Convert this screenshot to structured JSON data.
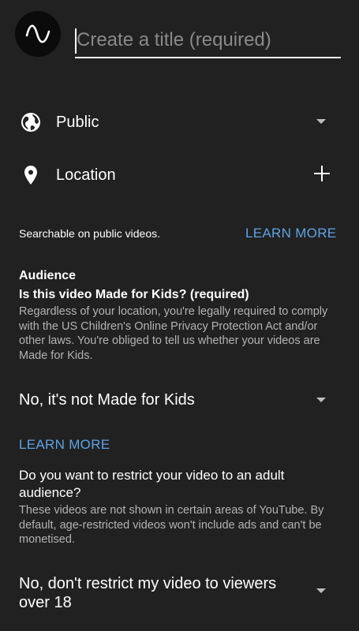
{
  "header": {
    "title_placeholder": "Create a title (required)",
    "title_value": ""
  },
  "visibility": {
    "label": "Public"
  },
  "location": {
    "label": "Location"
  },
  "location_note": {
    "text": "Searchable on public videos.",
    "learn_more": "LEARN MORE"
  },
  "audience": {
    "heading": "Audience",
    "question": "Is this video Made for Kids? (required)",
    "description": "Regardless of your location, you're legally required to comply with the US Children's Online Privacy Protection Act and/or other laws. You're obliged to tell us whether your videos are Made for Kids.",
    "selected": "No, it's not Made for Kids",
    "learn_more": "LEARN MORE"
  },
  "age_restriction": {
    "question": "Do you want to restrict your video to an adult audience?",
    "description": "These videos are not shown in certain areas of YouTube. By default, age-restricted videos won't include ads and can't be monetised.",
    "selected": "No, don't restrict my video to viewers over 18"
  },
  "colors": {
    "background": "#212121",
    "accent_link": "#5ea3e6",
    "secondary_text": "#b3b3b3"
  },
  "icons": {
    "thumbnail": "waveform-icon",
    "visibility": "globe-icon",
    "location": "location-pin-icon",
    "add": "plus-icon",
    "dropdown": "dropdown-arrow-icon"
  }
}
